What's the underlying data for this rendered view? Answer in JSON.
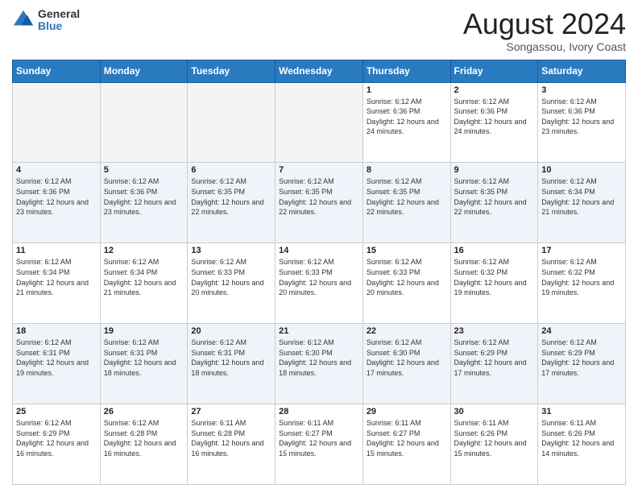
{
  "logo": {
    "general": "General",
    "blue": "Blue"
  },
  "title": "August 2024",
  "subtitle": "Songassou, Ivory Coast",
  "weekdays": [
    "Sunday",
    "Monday",
    "Tuesday",
    "Wednesday",
    "Thursday",
    "Friday",
    "Saturday"
  ],
  "weeks": [
    [
      {
        "day": "",
        "sunrise": "",
        "sunset": "",
        "daylight": ""
      },
      {
        "day": "",
        "sunrise": "",
        "sunset": "",
        "daylight": ""
      },
      {
        "day": "",
        "sunrise": "",
        "sunset": "",
        "daylight": ""
      },
      {
        "day": "",
        "sunrise": "",
        "sunset": "",
        "daylight": ""
      },
      {
        "day": "1",
        "sunrise": "Sunrise: 6:12 AM",
        "sunset": "Sunset: 6:36 PM",
        "daylight": "Daylight: 12 hours and 24 minutes."
      },
      {
        "day": "2",
        "sunrise": "Sunrise: 6:12 AM",
        "sunset": "Sunset: 6:36 PM",
        "daylight": "Daylight: 12 hours and 24 minutes."
      },
      {
        "day": "3",
        "sunrise": "Sunrise: 6:12 AM",
        "sunset": "Sunset: 6:36 PM",
        "daylight": "Daylight: 12 hours and 23 minutes."
      }
    ],
    [
      {
        "day": "4",
        "sunrise": "Sunrise: 6:12 AM",
        "sunset": "Sunset: 6:36 PM",
        "daylight": "Daylight: 12 hours and 23 minutes."
      },
      {
        "day": "5",
        "sunrise": "Sunrise: 6:12 AM",
        "sunset": "Sunset: 6:36 PM",
        "daylight": "Daylight: 12 hours and 23 minutes."
      },
      {
        "day": "6",
        "sunrise": "Sunrise: 6:12 AM",
        "sunset": "Sunset: 6:35 PM",
        "daylight": "Daylight: 12 hours and 22 minutes."
      },
      {
        "day": "7",
        "sunrise": "Sunrise: 6:12 AM",
        "sunset": "Sunset: 6:35 PM",
        "daylight": "Daylight: 12 hours and 22 minutes."
      },
      {
        "day": "8",
        "sunrise": "Sunrise: 6:12 AM",
        "sunset": "Sunset: 6:35 PM",
        "daylight": "Daylight: 12 hours and 22 minutes."
      },
      {
        "day": "9",
        "sunrise": "Sunrise: 6:12 AM",
        "sunset": "Sunset: 6:35 PM",
        "daylight": "Daylight: 12 hours and 22 minutes."
      },
      {
        "day": "10",
        "sunrise": "Sunrise: 6:12 AM",
        "sunset": "Sunset: 6:34 PM",
        "daylight": "Daylight: 12 hours and 21 minutes."
      }
    ],
    [
      {
        "day": "11",
        "sunrise": "Sunrise: 6:12 AM",
        "sunset": "Sunset: 6:34 PM",
        "daylight": "Daylight: 12 hours and 21 minutes."
      },
      {
        "day": "12",
        "sunrise": "Sunrise: 6:12 AM",
        "sunset": "Sunset: 6:34 PM",
        "daylight": "Daylight: 12 hours and 21 minutes."
      },
      {
        "day": "13",
        "sunrise": "Sunrise: 6:12 AM",
        "sunset": "Sunset: 6:33 PM",
        "daylight": "Daylight: 12 hours and 20 minutes."
      },
      {
        "day": "14",
        "sunrise": "Sunrise: 6:12 AM",
        "sunset": "Sunset: 6:33 PM",
        "daylight": "Daylight: 12 hours and 20 minutes."
      },
      {
        "day": "15",
        "sunrise": "Sunrise: 6:12 AM",
        "sunset": "Sunset: 6:33 PM",
        "daylight": "Daylight: 12 hours and 20 minutes."
      },
      {
        "day": "16",
        "sunrise": "Sunrise: 6:12 AM",
        "sunset": "Sunset: 6:32 PM",
        "daylight": "Daylight: 12 hours and 19 minutes."
      },
      {
        "day": "17",
        "sunrise": "Sunrise: 6:12 AM",
        "sunset": "Sunset: 6:32 PM",
        "daylight": "Daylight: 12 hours and 19 minutes."
      }
    ],
    [
      {
        "day": "18",
        "sunrise": "Sunrise: 6:12 AM",
        "sunset": "Sunset: 6:31 PM",
        "daylight": "Daylight: 12 hours and 19 minutes."
      },
      {
        "day": "19",
        "sunrise": "Sunrise: 6:12 AM",
        "sunset": "Sunset: 6:31 PM",
        "daylight": "Daylight: 12 hours and 18 minutes."
      },
      {
        "day": "20",
        "sunrise": "Sunrise: 6:12 AM",
        "sunset": "Sunset: 6:31 PM",
        "daylight": "Daylight: 12 hours and 18 minutes."
      },
      {
        "day": "21",
        "sunrise": "Sunrise: 6:12 AM",
        "sunset": "Sunset: 6:30 PM",
        "daylight": "Daylight: 12 hours and 18 minutes."
      },
      {
        "day": "22",
        "sunrise": "Sunrise: 6:12 AM",
        "sunset": "Sunset: 6:30 PM",
        "daylight": "Daylight: 12 hours and 17 minutes."
      },
      {
        "day": "23",
        "sunrise": "Sunrise: 6:12 AM",
        "sunset": "Sunset: 6:29 PM",
        "daylight": "Daylight: 12 hours and 17 minutes."
      },
      {
        "day": "24",
        "sunrise": "Sunrise: 6:12 AM",
        "sunset": "Sunset: 6:29 PM",
        "daylight": "Daylight: 12 hours and 17 minutes."
      }
    ],
    [
      {
        "day": "25",
        "sunrise": "Sunrise: 6:12 AM",
        "sunset": "Sunset: 6:29 PM",
        "daylight": "Daylight: 12 hours and 16 minutes."
      },
      {
        "day": "26",
        "sunrise": "Sunrise: 6:12 AM",
        "sunset": "Sunset: 6:28 PM",
        "daylight": "Daylight: 12 hours and 16 minutes."
      },
      {
        "day": "27",
        "sunrise": "Sunrise: 6:11 AM",
        "sunset": "Sunset: 6:28 PM",
        "daylight": "Daylight: 12 hours and 16 minutes."
      },
      {
        "day": "28",
        "sunrise": "Sunrise: 6:11 AM",
        "sunset": "Sunset: 6:27 PM",
        "daylight": "Daylight: 12 hours and 15 minutes."
      },
      {
        "day": "29",
        "sunrise": "Sunrise: 6:11 AM",
        "sunset": "Sunset: 6:27 PM",
        "daylight": "Daylight: 12 hours and 15 minutes."
      },
      {
        "day": "30",
        "sunrise": "Sunrise: 6:11 AM",
        "sunset": "Sunset: 6:26 PM",
        "daylight": "Daylight: 12 hours and 15 minutes."
      },
      {
        "day": "31",
        "sunrise": "Sunrise: 6:11 AM",
        "sunset": "Sunset: 6:26 PM",
        "daylight": "Daylight: 12 hours and 14 minutes."
      }
    ]
  ]
}
